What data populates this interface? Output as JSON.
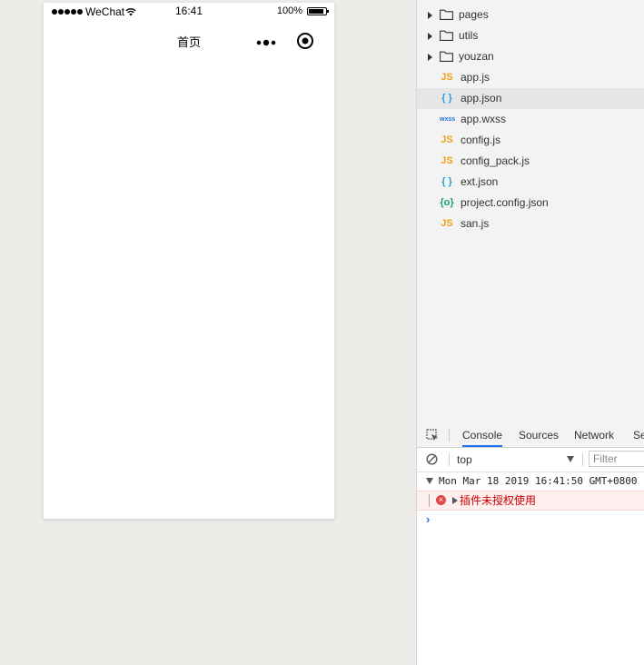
{
  "simulator": {
    "status": {
      "carrier": "WeChat",
      "time": "16:41",
      "battery": "100%",
      "battery_level": 1.0
    },
    "navbar": {
      "title": "首页"
    }
  },
  "file_tree": [
    {
      "type": "folder",
      "name": "pages"
    },
    {
      "type": "folder",
      "name": "utils"
    },
    {
      "type": "folder",
      "name": "youzan"
    },
    {
      "type": "file",
      "name": "app.js",
      "icon": "js-file-icon",
      "badge": "JS",
      "color": "#f0a21a"
    },
    {
      "type": "file",
      "name": "app.json",
      "icon": "json-file-icon",
      "badge": "{ }",
      "color": "#2b9fd6",
      "selected": true
    },
    {
      "type": "file",
      "name": "app.wxss",
      "icon": "wxss-file-icon",
      "badge": "wxss",
      "color": "#1f6fd1"
    },
    {
      "type": "file",
      "name": "config.js",
      "icon": "js-file-icon",
      "badge": "JS",
      "color": "#f0a21a"
    },
    {
      "type": "file",
      "name": "config_pack.js",
      "icon": "js-file-icon",
      "badge": "JS",
      "color": "#f0a21a"
    },
    {
      "type": "file",
      "name": "ext.json",
      "icon": "json-file-icon",
      "badge": "{ }",
      "color": "#2b9fd6"
    },
    {
      "type": "file",
      "name": "project.config.json",
      "icon": "config-json-icon",
      "badge": "{o}",
      "color": "#1aa070"
    },
    {
      "type": "file",
      "name": "san.js",
      "icon": "js-file-icon",
      "badge": "JS",
      "color": "#f0a21a"
    }
  ],
  "devtools": {
    "tabs": [
      {
        "label": "Console",
        "active": true
      },
      {
        "label": "Sources",
        "active": false
      },
      {
        "label": "Network",
        "active": false
      },
      {
        "label": "Se",
        "active": false
      }
    ],
    "context": "top",
    "filter_placeholder": "Filter",
    "console": {
      "group_header": "Mon Mar 18 2019 16:41:50 GMT+0800",
      "error_message": "插件未授权使用",
      "prompt": "›"
    }
  }
}
